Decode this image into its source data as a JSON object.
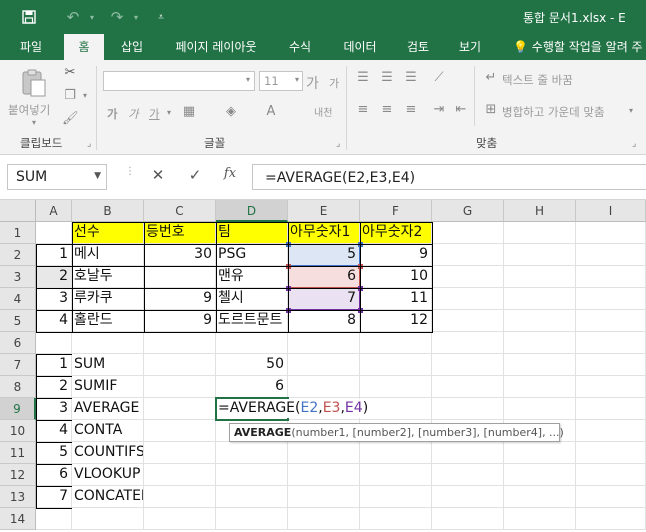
{
  "app": {
    "title": "통합 문서1.xlsx - E",
    "accent": "#217346"
  },
  "quick_access": {
    "save_icon": "save-icon",
    "undo_icon": "undo-icon",
    "redo_icon": "redo-icon",
    "customize_icon": "customize-qat-icon"
  },
  "tabs": [
    {
      "label": "파일",
      "active": false
    },
    {
      "label": "홈",
      "active": true
    },
    {
      "label": "삽입",
      "active": false
    },
    {
      "label": "페이지 레이아웃",
      "active": false
    },
    {
      "label": "수식",
      "active": false
    },
    {
      "label": "데이터",
      "active": false
    },
    {
      "label": "검토",
      "active": false
    },
    {
      "label": "보기",
      "active": false
    }
  ],
  "tell_me": "수행할 작업을 알려 주",
  "ribbon": {
    "paste_label": "붙여넣기",
    "clipboard_group": "클립보드",
    "font_group": "글꼴",
    "alignment_group": "맞춤",
    "font_size": "11",
    "wrap_text": "텍스트 줄 바꿈",
    "merge_center": "병합하고 가운데 맞춤",
    "bold": "가",
    "italic": "가",
    "underline": "가",
    "grow_font": "가",
    "shrink_font": "가",
    "phonetic": "내천"
  },
  "formula_bar": {
    "name_box": "SUM",
    "cancel_glyph": "✕",
    "enter_glyph": "✓",
    "fx_label": "fx",
    "formula": "=AVERAGE(E2,E3,E4)"
  },
  "columns": [
    "A",
    "B",
    "C",
    "D",
    "E",
    "F",
    "G",
    "H",
    "I"
  ],
  "rows": [
    "1",
    "2",
    "3",
    "4",
    "5",
    "6",
    "7",
    "8",
    "9",
    "10",
    "11",
    "12",
    "13",
    "14"
  ],
  "cells": {
    "B1": "선수",
    "C1": "등번호",
    "D1": "팀",
    "E1": "아무숫자1",
    "F1": "아무숫자2",
    "A2": "1",
    "B2": "메시",
    "C2": "30",
    "D2": "PSG",
    "E2": "5",
    "F2": "9",
    "A3": "2",
    "B3": "호날두",
    "D3": "맨유",
    "E3": "6",
    "F3": "10",
    "A4": "3",
    "B4": "루카쿠",
    "C4": "9",
    "D4": "첼시",
    "E4": "7",
    "F4": "11",
    "A5": "4",
    "B5": "홀란드",
    "C5": "9",
    "D5": "도르트문트",
    "E5": "8",
    "F5": "12",
    "A7": "1",
    "B7": "SUM",
    "D7": "50",
    "A8": "2",
    "B8": "SUMIF",
    "D8": "6",
    "A9": "3",
    "B9": "AVERAGE",
    "A10": "4",
    "B10": "CONTA",
    "A11": "5",
    "B11": "COUNTIFS",
    "A12": "6",
    "B12": "VLOOKUP",
    "A13": "7",
    "B13": "CONCATENATE"
  },
  "edit_cell": {
    "prefix": "=AVERAGE(",
    "ref1": "E2",
    "ref2": "E3",
    "ref3": "E4",
    "comma": ",",
    "suffix": ")",
    "ref1_color": "#4472c4",
    "ref2_color": "#c0504d",
    "ref3_color": "#7030a0"
  },
  "tooltip": {
    "func": "AVERAGE",
    "args": "(number1, [number2], [number3], [number4], ...)"
  }
}
